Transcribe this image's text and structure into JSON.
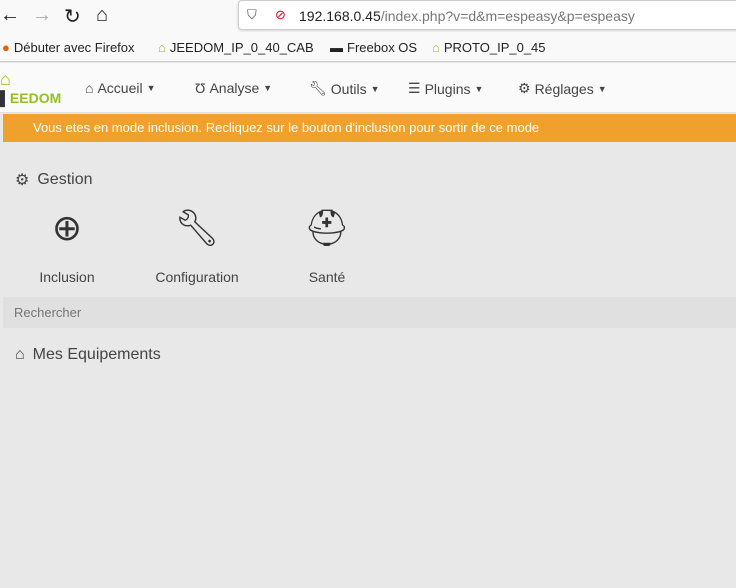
{
  "browser": {
    "url_host": "192.168.0.45",
    "url_path": "/index.php?v=d&m=espeasy&p=espeasy",
    "bookmarks": [
      "Débuter avec Firefox",
      "JEEDOM_IP_0_40_CAB",
      "Freebox OS",
      "PROTO_IP_0_45"
    ]
  },
  "nav": {
    "logo": "EEDOM",
    "items": [
      "Accueil",
      "Analyse",
      "Outils",
      "Plugins",
      "Réglages"
    ]
  },
  "alert": "Vous etes en mode inclusion. Recliquez sur le bouton d'inclusion pour sortir de ce mode",
  "gestion": {
    "title": "Gestion",
    "cards": [
      "Inclusion",
      "Configuration",
      "Santé"
    ]
  },
  "search_placeholder": "Rechercher",
  "equipements_title": "Mes Equipements"
}
